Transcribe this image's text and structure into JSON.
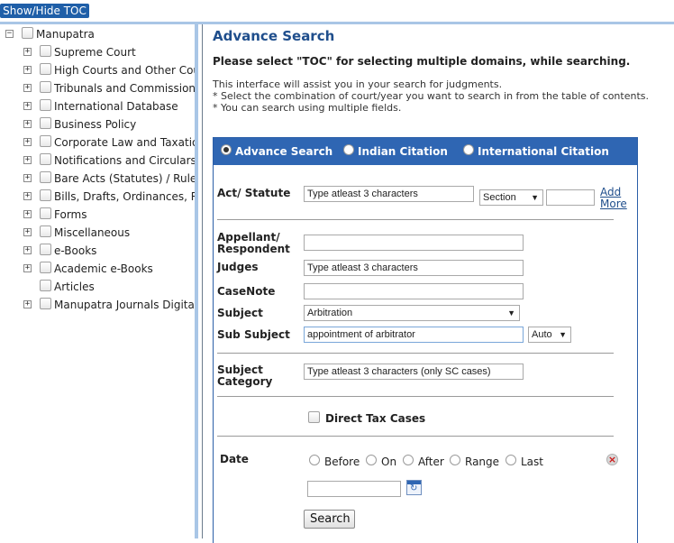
{
  "toc_toggle_label": "Show/Hide TOC",
  "toc": {
    "root": "Manupatra",
    "items": [
      {
        "label": "Supreme Court",
        "expandable": true
      },
      {
        "label": "High Courts and Other Cour",
        "expandable": true
      },
      {
        "label": "Tribunals and Commissions",
        "expandable": true
      },
      {
        "label": "International Database",
        "expandable": true
      },
      {
        "label": "Business Policy",
        "expandable": true
      },
      {
        "label": "Corporate Law and Taxation",
        "expandable": true
      },
      {
        "label": "Notifications and Circulars",
        "expandable": true
      },
      {
        "label": "Bare Acts (Statutes) / Rules",
        "expandable": true
      },
      {
        "label": "Bills, Drafts, Ordinances, Re",
        "expandable": true
      },
      {
        "label": "Forms",
        "expandable": true
      },
      {
        "label": "Miscellaneous",
        "expandable": true
      },
      {
        "label": "e-Books",
        "expandable": true
      },
      {
        "label": "Academic e-Books",
        "expandable": true
      },
      {
        "label": "Articles",
        "expandable": false
      },
      {
        "label": "Manupatra Journals Digital E",
        "expandable": true
      }
    ]
  },
  "main": {
    "title": "Advance Search",
    "instruction": "Please select  \"TOC\"  for selecting multiple domains, while searching.",
    "info_lines": [
      "This interface will assist you in your search for judgments.",
      "* Select the combination of court/year you want to search in from the table of contents.",
      "* You can search using multiple fields."
    ]
  },
  "search_tabs": [
    {
      "label": "Advance Search",
      "selected": true
    },
    {
      "label": "Indian Citation",
      "selected": false
    },
    {
      "label": "International Citation",
      "selected": false
    }
  ],
  "form": {
    "act_label": "Act/ Statute",
    "act_placeholder": "Type atleast 3 characters",
    "section_select": "Section",
    "add_more": [
      "Add",
      "More"
    ],
    "appellant_label": [
      "Appellant/",
      "Respondent"
    ],
    "appellant_value": "",
    "judges_label": "Judges",
    "judges_placeholder": "Type atleast 3 characters",
    "casenote_label": "CaseNote",
    "casenote_value": "",
    "subject_label": "Subject",
    "subject_value": "Arbitration",
    "sub_subject_label": "Sub Subject",
    "sub_subject_value": "appointment of arbitrator",
    "sub_subject_mode": "Auto",
    "category_label": [
      "Subject",
      "Category"
    ],
    "category_placeholder": "Type atleast 3 characters (only SC cases)",
    "direct_tax_label": "Direct Tax Cases",
    "date_label": "Date",
    "date_options": [
      "Before",
      "On",
      "After",
      "Range",
      "Last"
    ],
    "date_value": "",
    "search_button": "Search"
  },
  "colors": {
    "panel_header": "#2f66b3",
    "title_blue": "#1f4e8c",
    "toc_button": "#1f5fa8",
    "splitter": "#a9c6e6"
  }
}
